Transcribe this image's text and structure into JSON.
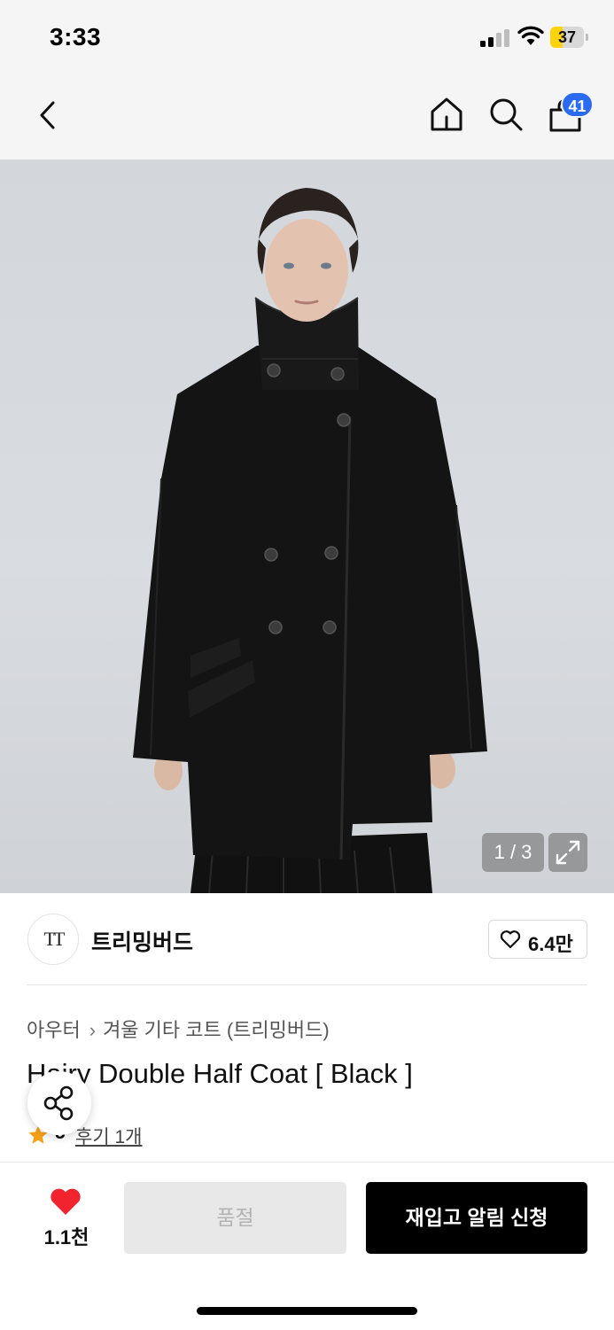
{
  "status_bar": {
    "time": "3:33",
    "battery": "37",
    "battery_level": 0.37
  },
  "nav": {
    "cart_count": "41"
  },
  "gallery": {
    "counter": "1 / 3"
  },
  "brand": {
    "logo_text": "TT",
    "name": "트리밍버드",
    "likes": "6.4만"
  },
  "breadcrumb": {
    "parent": "아우터",
    "separator": "›",
    "current": "겨울 기타 코트 (트리밍버드)"
  },
  "product": {
    "title": "Hairy Double Half Coat [ Black ]",
    "rating": "5",
    "reviews": "후기 1개"
  },
  "actions": {
    "wish_count": "1.1천",
    "soldout_label": "품절",
    "restock_label": "재입고 알림 신청"
  },
  "colors": {
    "accent_blue": "#2a6bf2",
    "heart_red": "#f0232f",
    "star_orange": "#f6a019",
    "primary_black": "#000000"
  },
  "icons": [
    "back-icon",
    "home-icon",
    "search-icon",
    "cart-icon",
    "expand-icon",
    "heart-outline-icon",
    "share-icon",
    "star-icon",
    "heart-icon"
  ]
}
